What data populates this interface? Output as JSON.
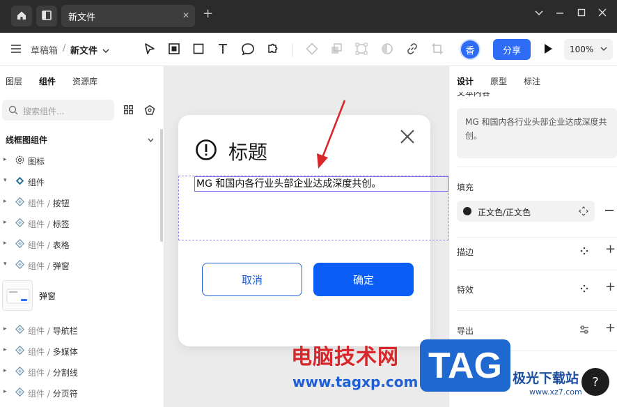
{
  "titlebar": {
    "tab_title": "新文件",
    "tab_close": "✕",
    "new_tab": "+",
    "controls": [
      "⌄",
      "—",
      "☐",
      "✕"
    ]
  },
  "toolbar": {
    "breadcrumb_parent": "草稿箱",
    "breadcrumb_sep": "/",
    "breadcrumb_current": "新文件",
    "avatar": "香",
    "share_label": "分享",
    "zoom_label": "100%"
  },
  "left_panel": {
    "tabs": [
      "图层",
      "组件",
      "资源库"
    ],
    "search_placeholder": "搜索组件...",
    "section_title": "线框图组件",
    "items": [
      {
        "prefix": "",
        "label": "图标",
        "arrow": "▸"
      },
      {
        "prefix": "",
        "label": "组件",
        "arrow": "▾"
      },
      {
        "prefix": "组件 / ",
        "label": "按钮",
        "arrow": "▸"
      },
      {
        "prefix": "组件 / ",
        "label": "标签",
        "arrow": "▸"
      },
      {
        "prefix": "组件 / ",
        "label": "表格",
        "arrow": "▸"
      },
      {
        "prefix": "组件 / ",
        "label": "弹窗",
        "arrow": "▾"
      },
      {
        "prefix": "组件 / ",
        "label": "导航栏",
        "arrow": "▸"
      },
      {
        "prefix": "组件 / ",
        "label": "多媒体",
        "arrow": "▸"
      },
      {
        "prefix": "组件 / ",
        "label": "分割线",
        "arrow": "▸"
      },
      {
        "prefix": "组件 / ",
        "label": "分页符",
        "arrow": "▸"
      }
    ],
    "thumb_label": "弹窗"
  },
  "canvas": {
    "dialog_title": "标题",
    "dialog_text": "MG 和国内各行业头部企业达成深度共创。",
    "cancel_label": "取消",
    "ok_label": "确定",
    "watermark_cn": "电脑技术网",
    "watermark_url": "www.tagxp.com"
  },
  "right_panel": {
    "tabs": [
      "设计",
      "原型",
      "标注"
    ],
    "text_section": "文本内容",
    "text_content": "MG 和国内各行业头部企业达成深度共创。",
    "fill_section": "填充",
    "fill_value": "正文色/正文色",
    "stroke_section": "描边",
    "effects_section": "特效",
    "export_section": "导出",
    "help": "?",
    "tag_logo": "TAG",
    "xz_logo": "极光下载站",
    "xz_url": "www.xz7.com"
  },
  "colors": {
    "accent": "#2f6cf6",
    "ok_button": "#0a5ef5",
    "selection": "#7f69ee",
    "annotation_arrow": "#d9262a"
  }
}
